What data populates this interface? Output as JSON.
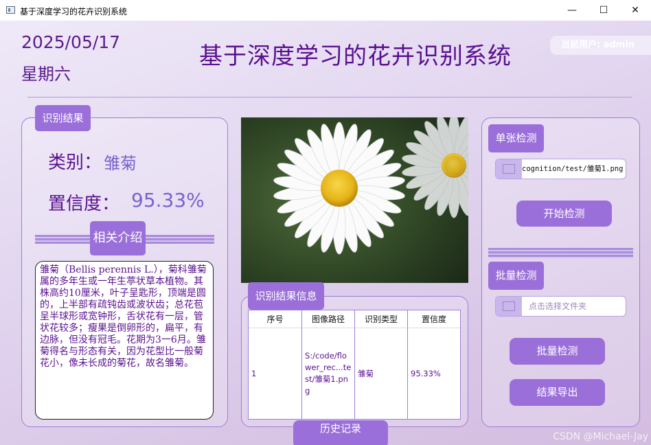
{
  "window": {
    "title": "基于深度学习的花卉识别系统",
    "controls": [
      "—",
      "☐",
      "✕"
    ]
  },
  "header": {
    "date": "2025/05/17",
    "weekday": "星期六",
    "title": "基于深度学习的花卉识别系统",
    "user": "当前用户: admin"
  },
  "result_panel": {
    "tag": "识别结果",
    "category_label": "类别：",
    "category_value": "雏菊",
    "confidence_label": "置信度：",
    "confidence_value": "95.33%",
    "intro_tag": "相关介绍",
    "description": "雏菊（Bellis perennis L.），菊科雏菊属的多年生或一年生葶状草本植物。其株高约10厘米，叶子呈匙形，顶端是圆的，上半部有疏钝齿或波状齿；总花苞呈半球形或宽钟形，舌状花有一层，管状花较多；瘦果是倒卵形的，扁平，有边脉，但没有冠毛。花期为3一6月。雏菊得名与形态有关，因为花型比一般菊花小，像未长成的菊花，故名雏菊。"
  },
  "info_panel": {
    "tag": "识别结果信息",
    "columns": [
      "序号",
      "图像路径",
      "识别类型",
      "置信度"
    ],
    "rows": [
      {
        "index": "1",
        "path": "S:/code/flower_rec...test/雏菊1.png",
        "type": "雏菊",
        "confidence": "95.33%"
      }
    ],
    "bottom_tab": "历史记录"
  },
  "right_panel": {
    "single_tag": "单张检测",
    "single_path": "cognition/test/雏菊1.png",
    "start_button": "开始检测",
    "batch_tag": "批量检测",
    "folder_placeholder": "点击选择文件夹",
    "batch_button": "批量检测",
    "export_button": "结果导出"
  },
  "watermark": "CSDN @Michael-Jay",
  "colors": {
    "accent": "#9b6fd9",
    "text": "#5a1090",
    "value": "#7b62d0"
  }
}
